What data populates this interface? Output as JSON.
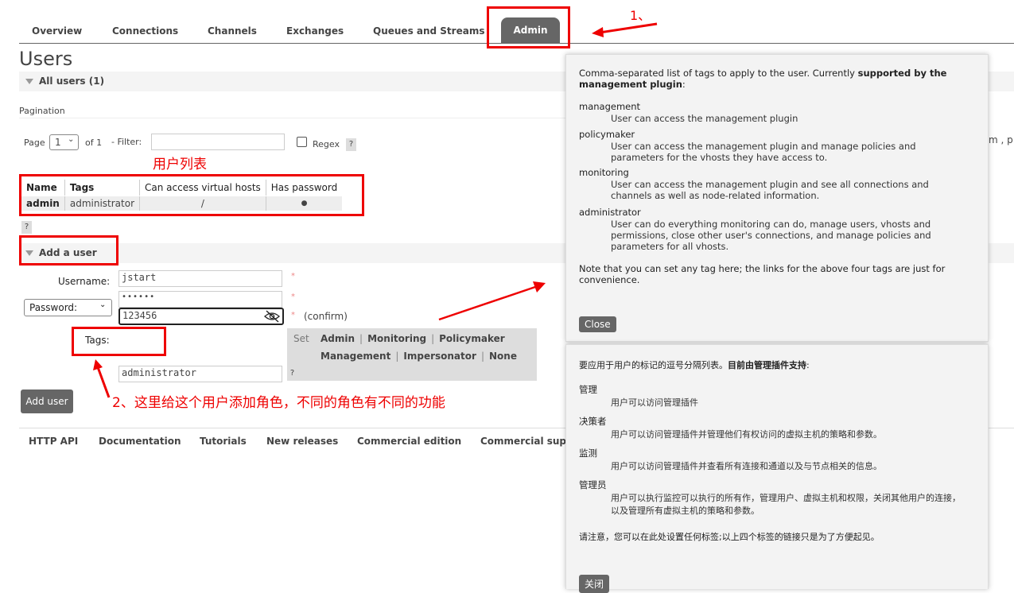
{
  "nav": {
    "tabs": [
      "Overview",
      "Connections",
      "Channels",
      "Exchanges",
      "Queues and Streams"
    ],
    "active": "Admin"
  },
  "page_title": "Users",
  "all_users": {
    "label": "All users (1)"
  },
  "pagination": {
    "heading": "Pagination",
    "page_label": "Page",
    "page_value": "1",
    "of_label": "of 1",
    "filter_label": "- Filter:",
    "filter_value": "",
    "regex_label": "Regex",
    "help": "?"
  },
  "annotation_user_list": "用户列表",
  "users_table": {
    "headers": [
      "Name",
      "Tags",
      "Can access virtual hosts",
      "Has password"
    ],
    "rows": [
      {
        "name": "admin",
        "tags": "administrator",
        "vhosts": "/",
        "has_password": "●"
      }
    ],
    "help": "?"
  },
  "add_user": {
    "label": "Add a user",
    "username_label": "Username:",
    "username_value": "jstart",
    "password_select": "Password:",
    "password_value": "••••••",
    "confirm_value": "123456",
    "confirm_label": "(confirm)",
    "required": "*",
    "tags_label": "Tags:",
    "tags_value": "administrator",
    "set_label": "Set",
    "tag_links": [
      "Admin",
      "Monitoring",
      "Policymaker",
      "Management",
      "Impersonator",
      "None"
    ],
    "button": "Add user",
    "help": "?"
  },
  "annotation_step1": "1、",
  "annotation_step2": "2、这里给这个用户添加角色，不同的角色有不同的功能",
  "footer": {
    "links": [
      "HTTP API",
      "Documentation",
      "Tutorials",
      "New releases",
      "Commercial edition",
      "Commercial sup"
    ]
  },
  "clipped_right": [
    "m , p"
  ],
  "tooltip_en": {
    "intro_a": "Comma-separated list of tags to apply to the user. Currently ",
    "intro_b": "supported by the management plugin",
    "intro_c": ":",
    "items": [
      {
        "term": "management",
        "def": "User can access the management plugin"
      },
      {
        "term": "policymaker",
        "def": "User can access the management plugin and manage policies and parameters for the vhosts they have access to."
      },
      {
        "term": "monitoring",
        "def": "User can access the management plugin and see all connections and channels as well as node-related information."
      },
      {
        "term": "administrator",
        "def": "User can do everything monitoring can do, manage users, vhosts and permissions, close other user's connections, and manage policies and parameters for all vhosts."
      }
    ],
    "note": "Note that you can set any tag here; the links for the above four tags are just for convenience.",
    "close": "Close"
  },
  "tooltip_zh": {
    "intro_a": "要应用于用户的标记的逗号分隔列表。",
    "intro_b": "目前由管理插件支持",
    "intro_c": ":",
    "items": [
      {
        "term": "管理",
        "def": "用户可以访问管理插件"
      },
      {
        "term": "决策者",
        "def": "用户可以访问管理插件并管理他们有权访问的虚拟主机的策略和参数。"
      },
      {
        "term": "监测",
        "def": "用户可以访问管理插件并查看所有连接和通道以及与节点相关的信息。"
      },
      {
        "term": "管理员",
        "def": "用户可以执行监控可以执行的所有作，管理用户、虚拟主机和权限，关闭其他用户的连接，以及管理所有虚拟主机的策略和参数。"
      }
    ],
    "note": "请注意，您可以在此处设置任何标签;以上四个标签的链接只是为了方便起见。",
    "close": "关闭"
  }
}
